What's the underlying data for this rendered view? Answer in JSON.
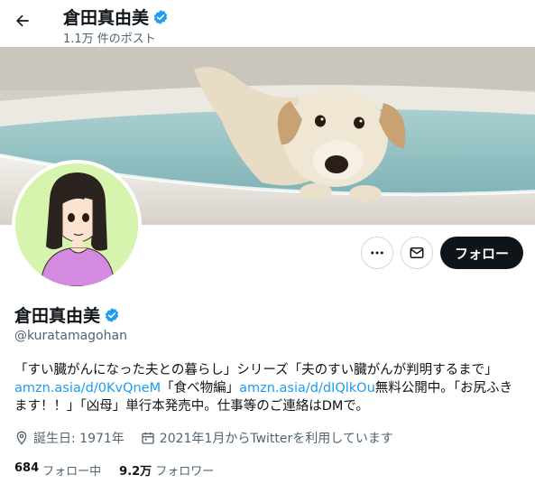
{
  "header": {
    "title": "倉田真由美",
    "post_count": "1.1万 件のポスト"
  },
  "profile": {
    "name": "倉田真由美",
    "handle": "@kuratamagohan",
    "bio": {
      "part1": "「すい臓がんになった夫との暮らし」シリーズ「夫のすい臓がんが判明するまで」",
      "link1": "amzn.asia/d/0KvQneM",
      "part2": "「食べ物編」",
      "link2": "amzn.asia/d/dIQlkOu",
      "part3": "無料公開中。「お尻ふきます！！」「凶母」単行本発売中。仕事等のご連絡はDMで。"
    },
    "birth": "誕生日: 1971年",
    "joined": "2021年1月からTwitterを利用しています",
    "following_count": "684",
    "following_label": "フォロー中",
    "followers_count": "9.2万",
    "followers_label": "フォロワー"
  },
  "actions": {
    "follow_label": "フォロー"
  },
  "icons": {
    "back": "back-arrow-icon",
    "more": "more-icon",
    "message": "mail-icon",
    "verified": "verified-badge-icon",
    "location": "location-icon",
    "calendar": "calendar-icon"
  },
  "colors": {
    "accent": "#1d9bf0",
    "text": "#0f1419",
    "muted": "#536471",
    "follow_bg": "#0f1419"
  }
}
